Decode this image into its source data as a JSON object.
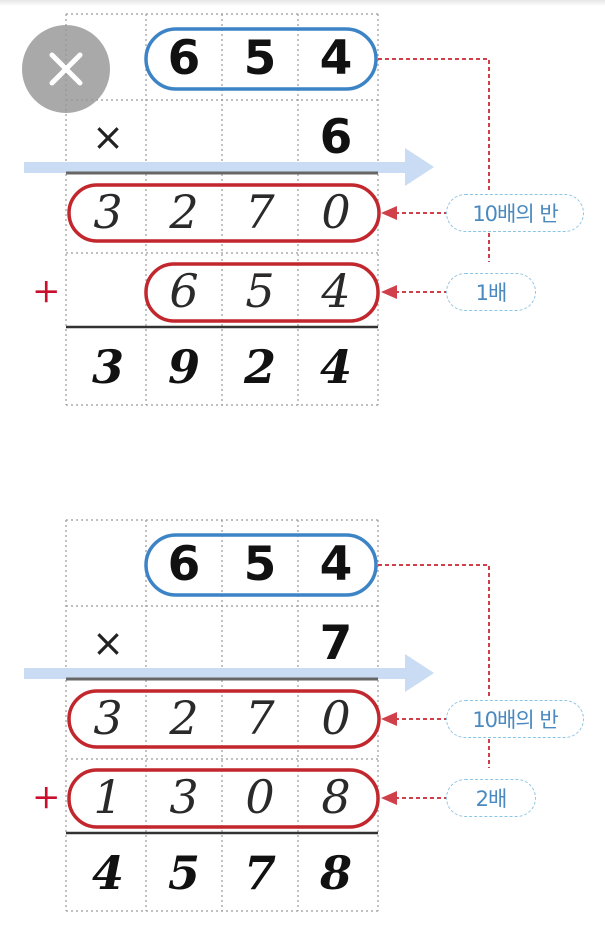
{
  "colors": {
    "multiplicand_outline": "#3d84c6",
    "partial_outline": "#c1272d",
    "connector": "#d0404a",
    "label_text": "#4a8ac0",
    "guide_arrow": "#c9dcf3"
  },
  "icons": {
    "close": "close-icon"
  },
  "problems": [
    {
      "multiplicand": [
        "6",
        "5",
        "4"
      ],
      "operator": "×",
      "multiplier": "6",
      "partial_1": [
        "3",
        "2",
        "7",
        "0"
      ],
      "plus_sign": "+",
      "partial_2": [
        "",
        "6",
        "5",
        "4"
      ],
      "result": [
        "3",
        "9",
        "2",
        "4"
      ],
      "label_1": "10배의 반",
      "label_2": "1배"
    },
    {
      "multiplicand": [
        "6",
        "5",
        "4"
      ],
      "operator": "×",
      "multiplier": "7",
      "partial_1": [
        "3",
        "2",
        "7",
        "0"
      ],
      "plus_sign": "+",
      "partial_2": [
        "1",
        "3",
        "0",
        "8"
      ],
      "result": [
        "4",
        "5",
        "7",
        "8"
      ],
      "label_1": "10배의 반",
      "label_2": "2배"
    }
  ]
}
